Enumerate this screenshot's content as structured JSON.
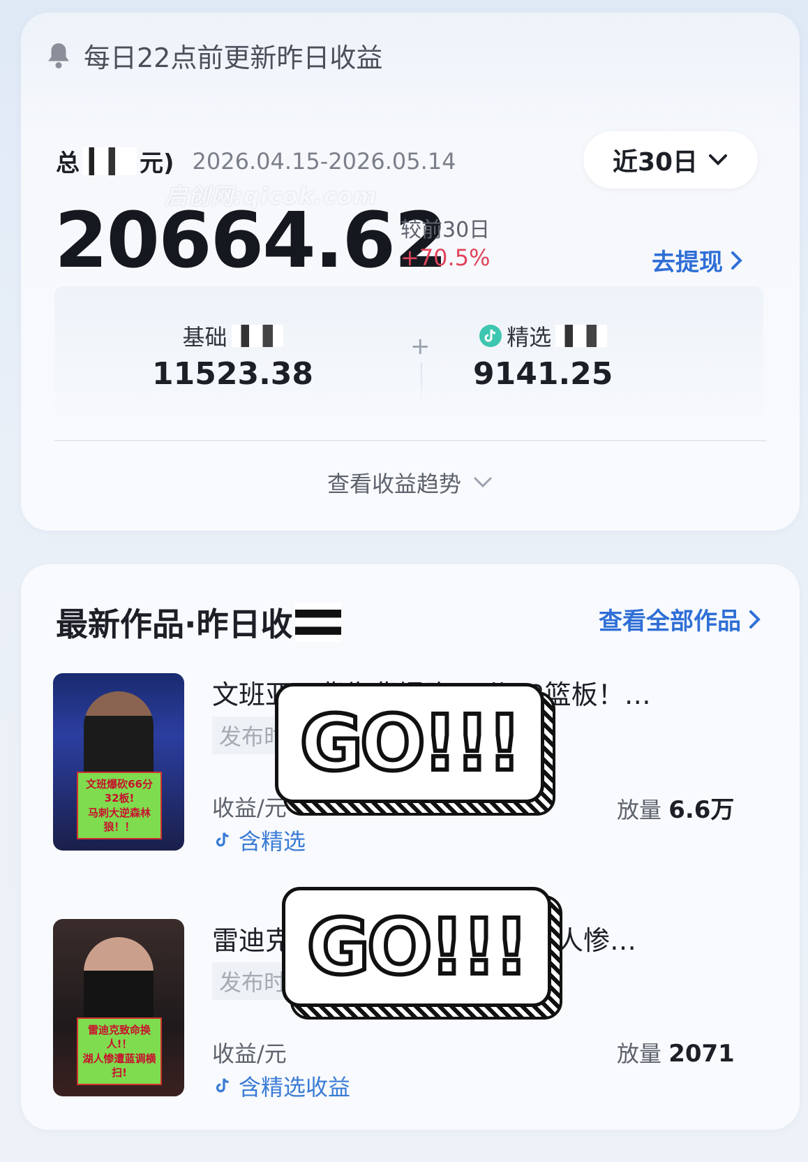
{
  "notice": {
    "text": "每日22点前更新昨日收益"
  },
  "summary": {
    "total_label_prefix": "总",
    "total_label_suffix": "元)",
    "date_range": "2026.04.15-2026.05.14",
    "period_selector": "近30日",
    "total_amount": "20664.62",
    "compare_label": "较前30日",
    "compare_value": "+70.5%",
    "withdraw_label": "去提现",
    "basic_label": "基础",
    "basic_value": "11523.38",
    "featured_label": "精选",
    "featured_value": "9141.25",
    "trend_label": "查看收益趋势"
  },
  "watermark": "启创网:qicok.com",
  "works_section": {
    "title": "最新作品·昨日收",
    "view_all_label": "查看全部作品"
  },
  "works": [
    {
      "title": "文班亚马背靠背爆砍66分32篮板！…",
      "publish_label": "发布时间",
      "earn_label": "收益/元",
      "views_label": "放量",
      "views_value": "6.6万",
      "featured_tag": "含精选",
      "thumb_caption_1": "文班爆砍66分32板!",
      "thumb_caption_2": "马刺大逆森林狼！！"
    },
    {
      "title": "雷迪克致命换人葬送比赛！湖人惨…",
      "publish_label": "发布时间",
      "earn_label": "收益/元",
      "views_label": "放量",
      "views_value": "2071",
      "featured_tag": "含精选收益",
      "thumb_caption_1": "雷迪克致命换人!！",
      "thumb_caption_2": "湖人惨遭蓝调横扫!"
    }
  ],
  "stickers": {
    "go_text": "GO!!!"
  }
}
